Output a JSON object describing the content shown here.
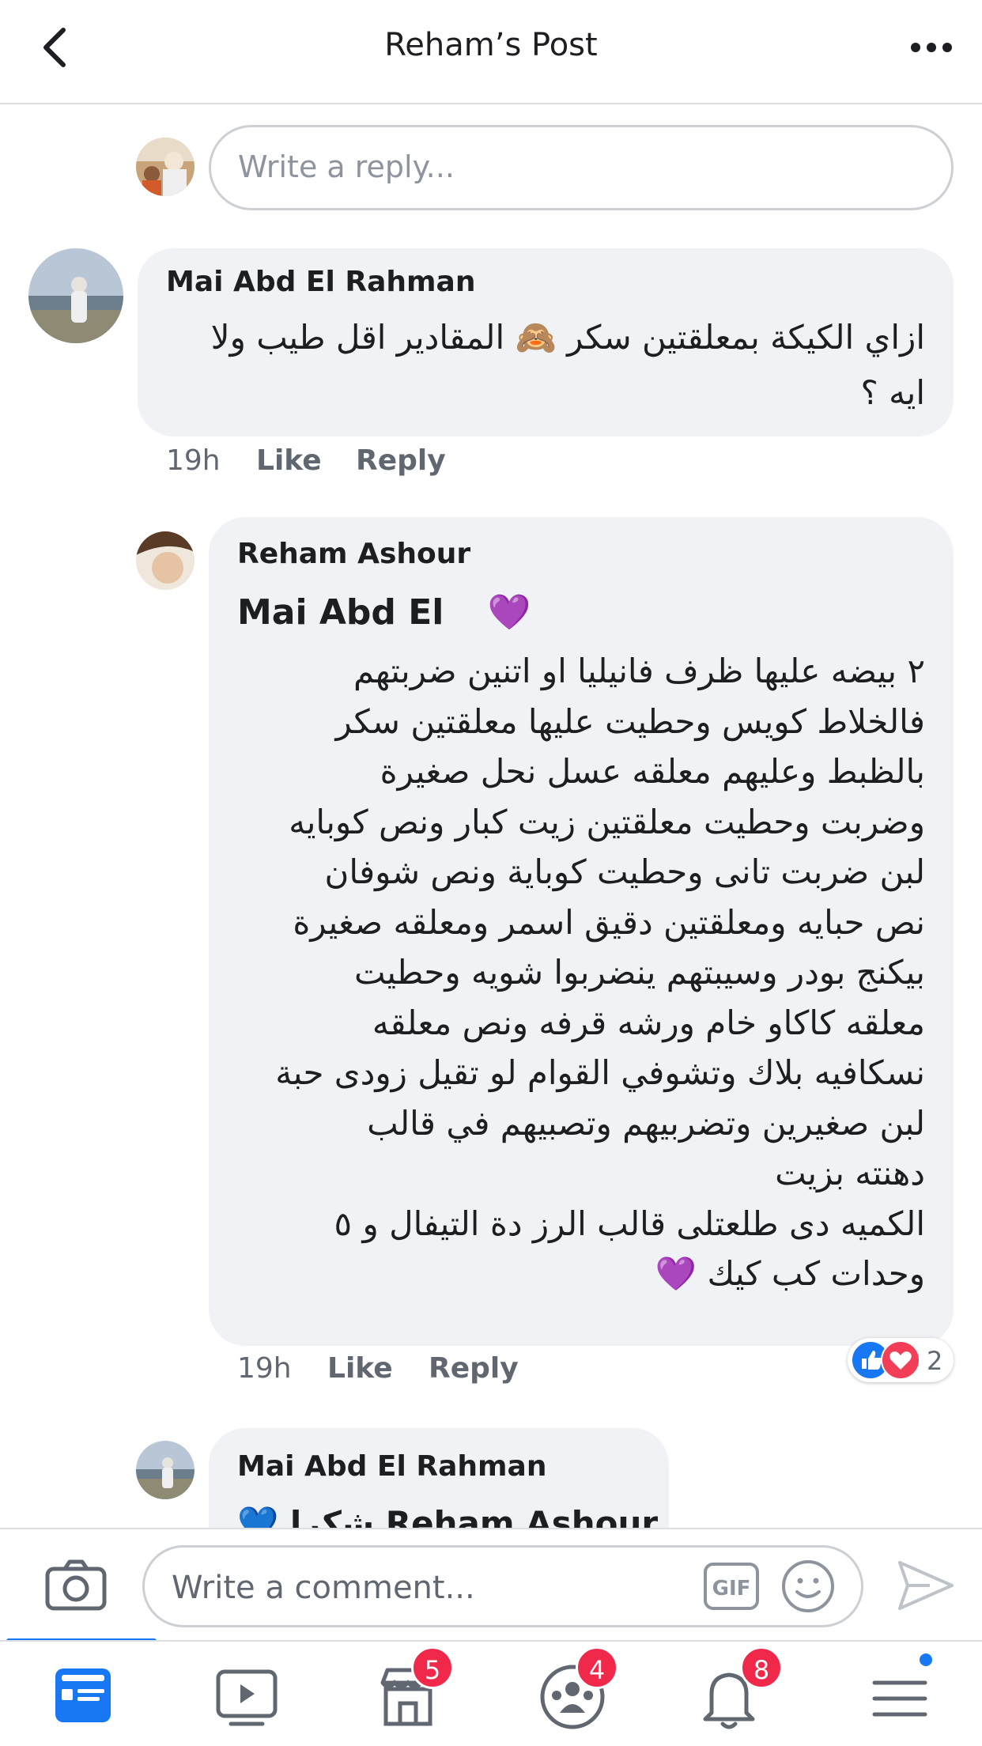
{
  "header": {
    "title": "Reham’s Post"
  },
  "reply_box": {
    "placeholder": "Write a reply..."
  },
  "comments": [
    {
      "author": "Mai Abd El Rahman",
      "text_lines": [
        "ازاي الكيكة بمعلقتين سكر 🙈 المقادير اقل طيب ولا",
        "ايه ؟"
      ],
      "time": "19h",
      "like_label": "Like",
      "reply_label": "Reply"
    },
    {
      "author": "Reham Ashour",
      "mention": "Mai Abd El",
      "mention_emoji": "💜",
      "text_lines": [
        "٢ بيضه عليها ظرف فانيليا او اتنين ضربتهم",
        "فالخلاط كويس وحطيت عليها معلقتين سكر",
        "بالظبط وعليهم معلقه عسل نحل صغيرة",
        "وضربت وحطيت معلقتين زيت كبار ونص كوبايه",
        "لبن ضربت تانى وحطيت كوباية ونص شوفان",
        "نص حبايه ومعلقتين دقيق اسمر ومعلقه صغيرة",
        "بيكنج بودر وسيبتهم ينضربوا شويه وحطيت",
        "معلقه كاكاو خام ورشه قرفه ونص معلقه",
        "نسكافيه بلاك وتشوفي القوام لو تقيل زودى حبة",
        "لبن صغيرين وتضربيهم وتصبيهم في قالب",
        "دهنته بزيت",
        "الكميه دى طلعتلى قالب الرز دة التيفال و ٥",
        "وحدات كب كيك 💜"
      ],
      "time": "19h",
      "like_label": "Like",
      "reply_label": "Reply",
      "reaction_count": "2"
    },
    {
      "author": "Mai Abd El Rahman",
      "text_partial": "Reham Ashour شكرا 💙"
    }
  ],
  "composer": {
    "placeholder": "Write a comment..."
  },
  "nav": {
    "marketplace_badge": "5",
    "groups_badge": "4",
    "notifications_badge": "8"
  },
  "colors": {
    "accent": "#1877f2",
    "badge": "#f02849",
    "bubble": "#f0f2f5"
  }
}
